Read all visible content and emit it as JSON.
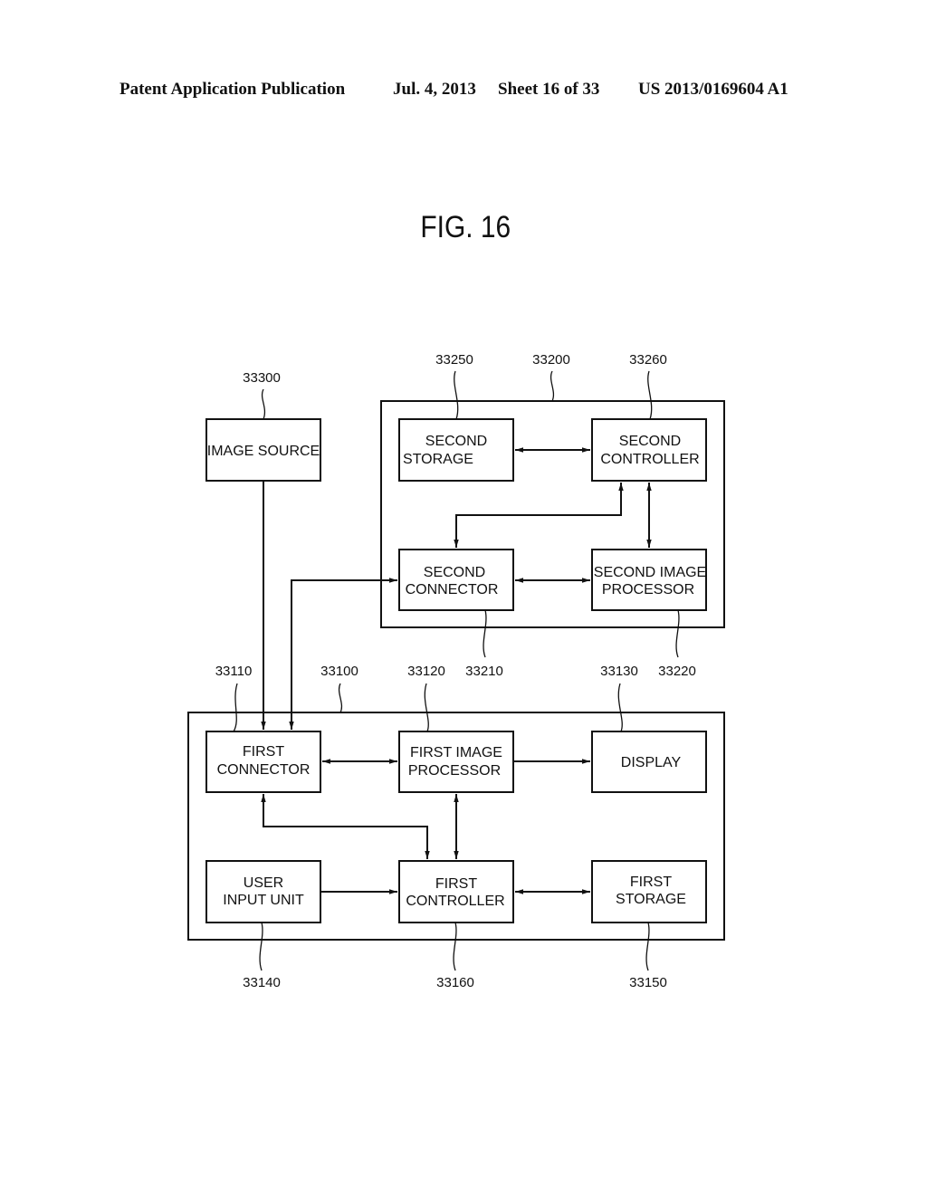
{
  "header": {
    "publication": "Patent Application Publication",
    "date": "Jul. 4, 2013",
    "sheet": "Sheet 16 of 33",
    "number": "US 2013/0169604 A1"
  },
  "figure": {
    "title": "FIG. 16",
    "blocks": {
      "image_source": {
        "lines": [
          "IMAGE SOURCE"
        ],
        "ref": "33300"
      },
      "second_device": {
        "ref": "33200"
      },
      "second_storage": {
        "lines": [
          "SECOND",
          "STORAGE"
        ],
        "ref": "33250"
      },
      "second_controller": {
        "lines": [
          "SECOND",
          "CONTROLLER"
        ],
        "ref": "33260"
      },
      "second_connector": {
        "lines": [
          "SECOND",
          "CONNECTOR"
        ],
        "ref": "33210"
      },
      "second_image_processor": {
        "lines": [
          "SECOND IMAGE",
          "PROCESSOR"
        ],
        "ref": "33220"
      },
      "first_device": {
        "ref": "33100"
      },
      "first_connector": {
        "lines": [
          "FIRST",
          "CONNECTOR"
        ],
        "ref": "33110"
      },
      "first_image_processor": {
        "lines": [
          "FIRST IMAGE",
          "PROCESSOR"
        ],
        "ref": "33120"
      },
      "display": {
        "lines": [
          "DISPLAY"
        ],
        "ref": "33130"
      },
      "user_input_unit": {
        "lines": [
          "USER",
          "INPUT UNIT"
        ],
        "ref": "33140"
      },
      "first_controller": {
        "lines": [
          "FIRST",
          "CONTROLLER"
        ],
        "ref": "33160"
      },
      "first_storage": {
        "lines": [
          "FIRST",
          "STORAGE"
        ],
        "ref": "33150"
      }
    },
    "connections": [
      {
        "from": "image_source",
        "to": "first_connector",
        "direction": "one-way"
      },
      {
        "from": "second_connector",
        "to": "first_connector",
        "direction": "bidirectional"
      },
      {
        "from": "second_storage",
        "to": "second_controller",
        "direction": "bidirectional"
      },
      {
        "from": "second_controller",
        "to": "second_connector",
        "direction": "bidirectional"
      },
      {
        "from": "second_controller",
        "to": "second_image_processor",
        "direction": "bidirectional"
      },
      {
        "from": "second_connector",
        "to": "second_image_processor",
        "direction": "bidirectional"
      },
      {
        "from": "first_connector",
        "to": "first_image_processor",
        "direction": "bidirectional"
      },
      {
        "from": "first_image_processor",
        "to": "display",
        "direction": "one-way"
      },
      {
        "from": "first_connector",
        "to": "first_controller",
        "direction": "bidirectional"
      },
      {
        "from": "first_image_processor",
        "to": "first_controller",
        "direction": "bidirectional"
      },
      {
        "from": "user_input_unit",
        "to": "first_controller",
        "direction": "one-way"
      },
      {
        "from": "first_controller",
        "to": "first_storage",
        "direction": "bidirectional"
      }
    ]
  }
}
